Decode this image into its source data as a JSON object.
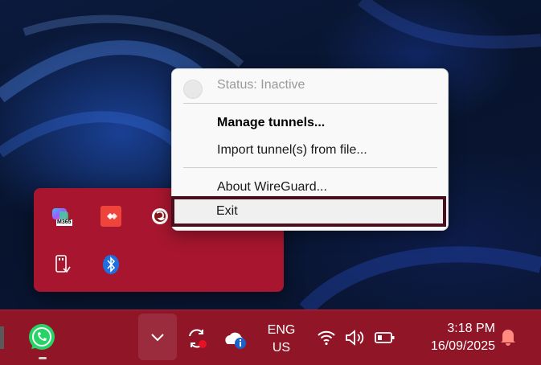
{
  "menu": {
    "status": "Status: Inactive",
    "manage": "Manage tunnels...",
    "import": "Import tunnel(s) from file...",
    "about": "About WireGuard...",
    "exit": "Exit"
  },
  "tray_overflow": {
    "icons": [
      "m365-copilot-icon",
      "anydesk-icon",
      "wireguard-icon",
      "usb-drive-icon",
      "bluetooth-icon"
    ],
    "m365_label": "M365"
  },
  "taskbar": {
    "language_line1": "ENG",
    "language_line2": "US",
    "time": "3:18 PM",
    "date": "16/09/2025"
  },
  "colors": {
    "taskbar": "#8f1527",
    "tray_overflow": "#a7162e",
    "menu_bg": "#f9f9f9",
    "exit_highlight_border": "#4a0f1e",
    "whatsapp": "#25d366"
  }
}
